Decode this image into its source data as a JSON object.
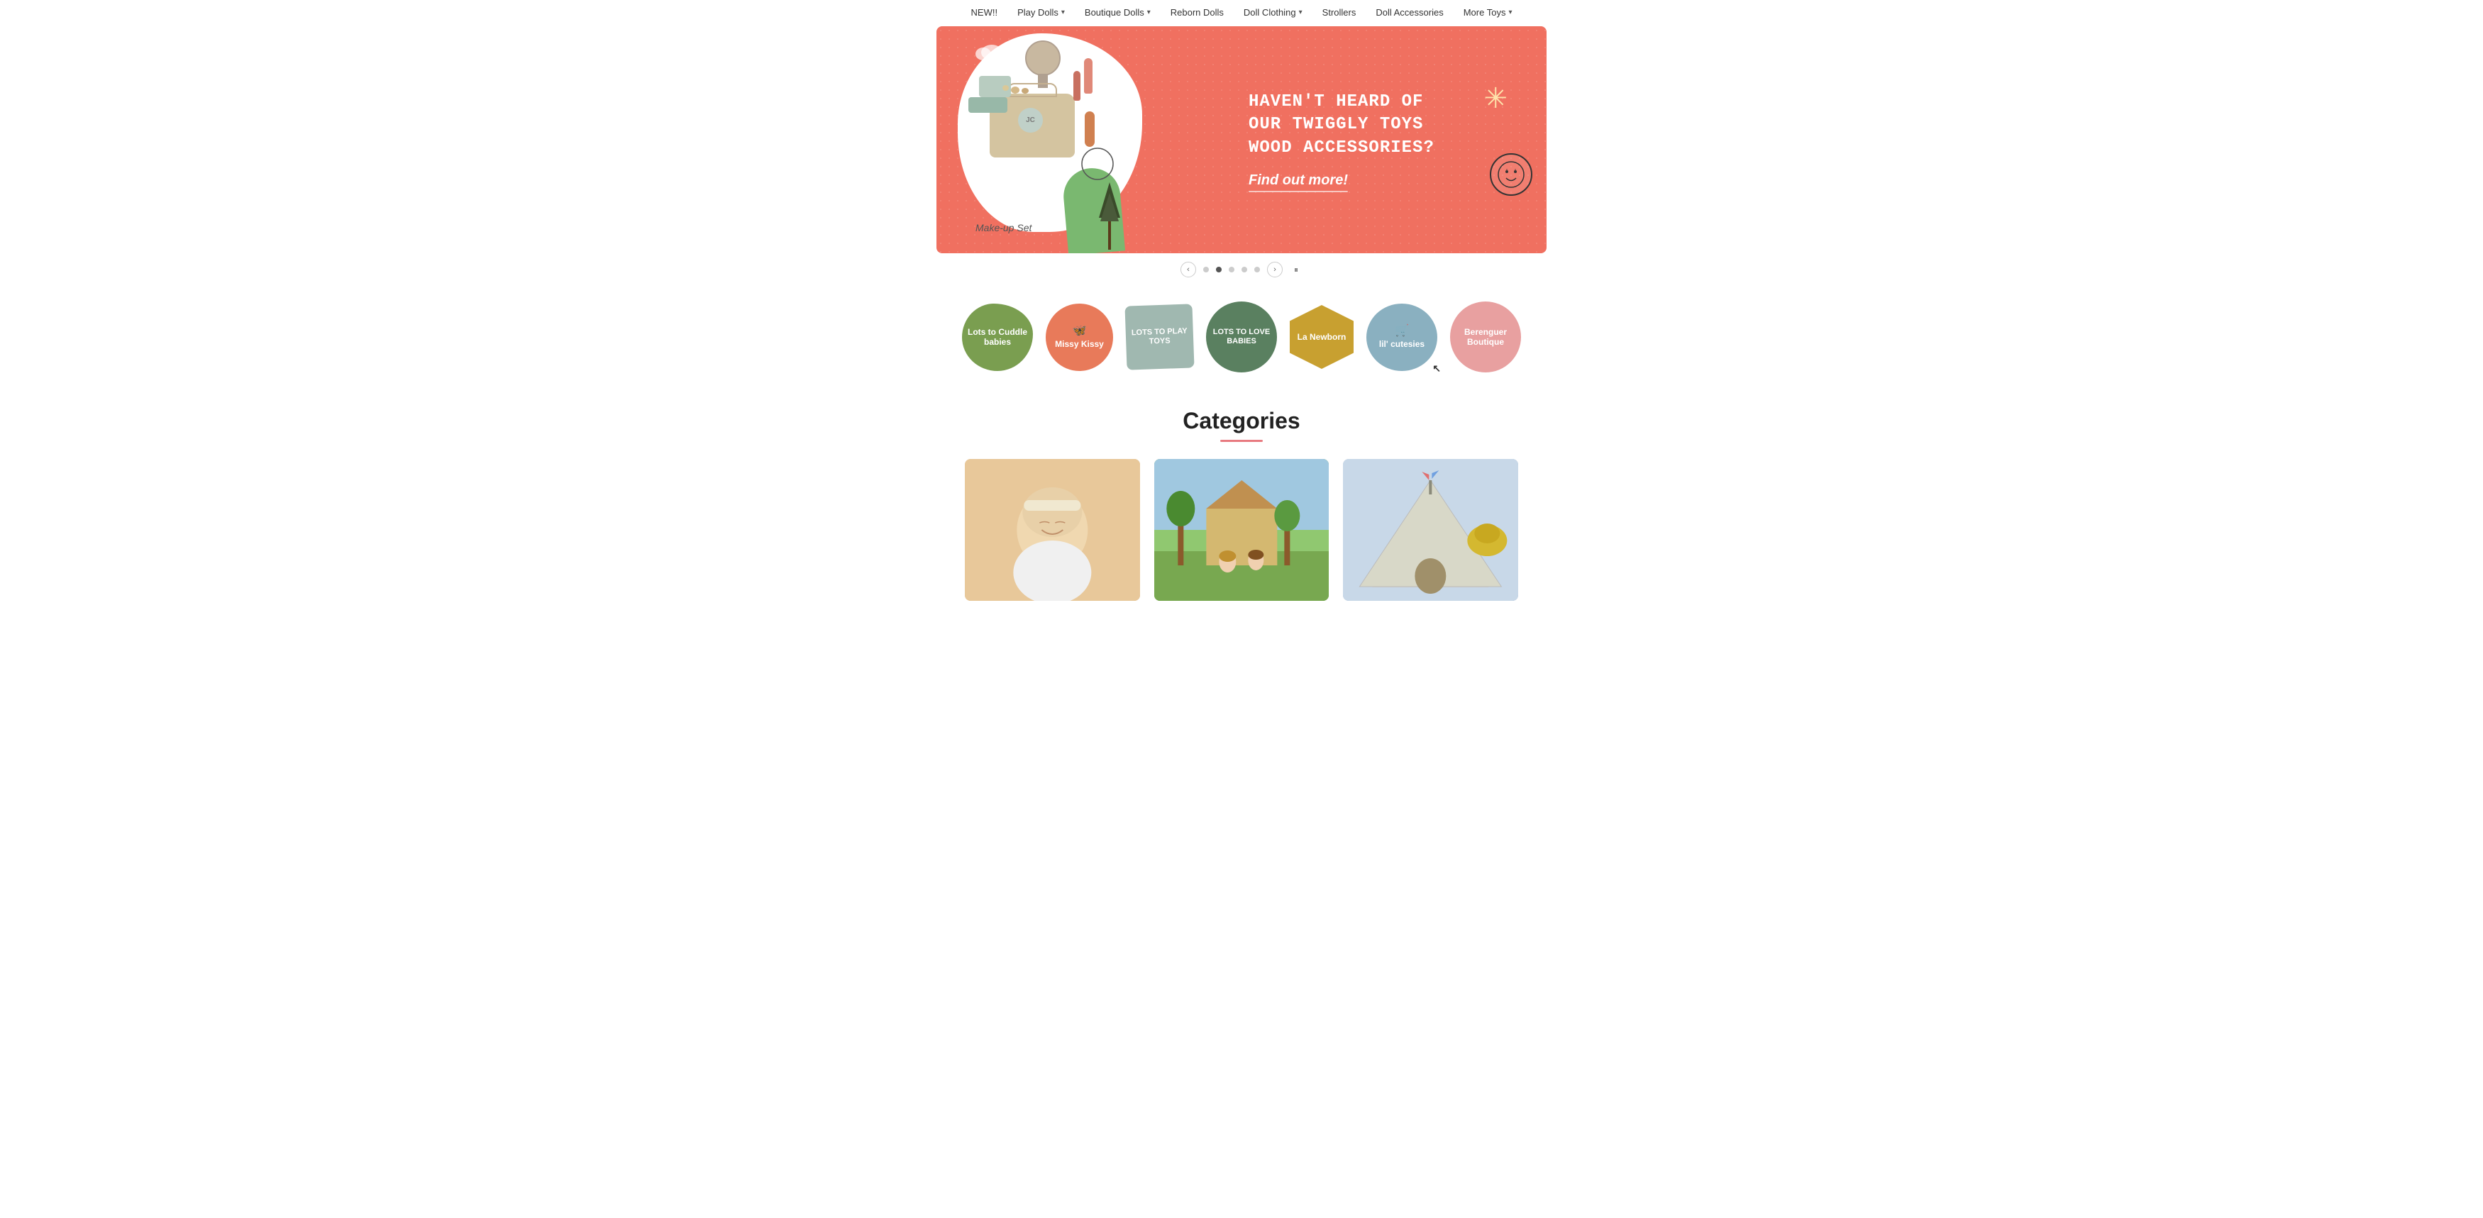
{
  "nav": {
    "items": [
      {
        "label": "NEW!!",
        "hasDropdown": false
      },
      {
        "label": "Play Dolls",
        "hasDropdown": true
      },
      {
        "label": "Boutique Dolls",
        "hasDropdown": true
      },
      {
        "label": "Reborn Dolls",
        "hasDropdown": false
      },
      {
        "label": "Doll Clothing",
        "hasDropdown": true
      },
      {
        "label": "Strollers",
        "hasDropdown": false
      },
      {
        "label": "Doll Accessories",
        "hasDropdown": false
      },
      {
        "label": "More Toys",
        "hasDropdown": true
      }
    ]
  },
  "banner": {
    "headline": "HAVEN'T HEARD OF\nOUR TWIGGLY TOYS\nWOOD ACCESSORIES?",
    "cta": "Find out more!",
    "makeupLabel": "Make-up Set"
  },
  "carousel": {
    "dots": [
      false,
      true,
      false,
      false,
      false
    ],
    "prevLabel": "‹",
    "nextLabel": "›",
    "pauseLabel": "⏸"
  },
  "brands": [
    {
      "label": "Lots to Cuddle babies",
      "shape": "lots-cuddle"
    },
    {
      "label": "Missy Kissy",
      "shape": "missy"
    },
    {
      "label": "LOTS TO PLAY TOYS",
      "shape": "lots-play"
    },
    {
      "label": "LOTS TO LOVE BABIES",
      "shape": "lots-love"
    },
    {
      "label": "La Newborn",
      "shape": "la-newborn"
    },
    {
      "label": "lil' cutesies",
      "shape": "lil-cutesies"
    },
    {
      "label": "Berenguer Boutique",
      "shape": "berenguer"
    }
  ],
  "categories": {
    "title": "Categories",
    "images": [
      {
        "alt": "baby doll category"
      },
      {
        "alt": "outdoor doll category"
      },
      {
        "alt": "playhouse doll category"
      }
    ]
  }
}
